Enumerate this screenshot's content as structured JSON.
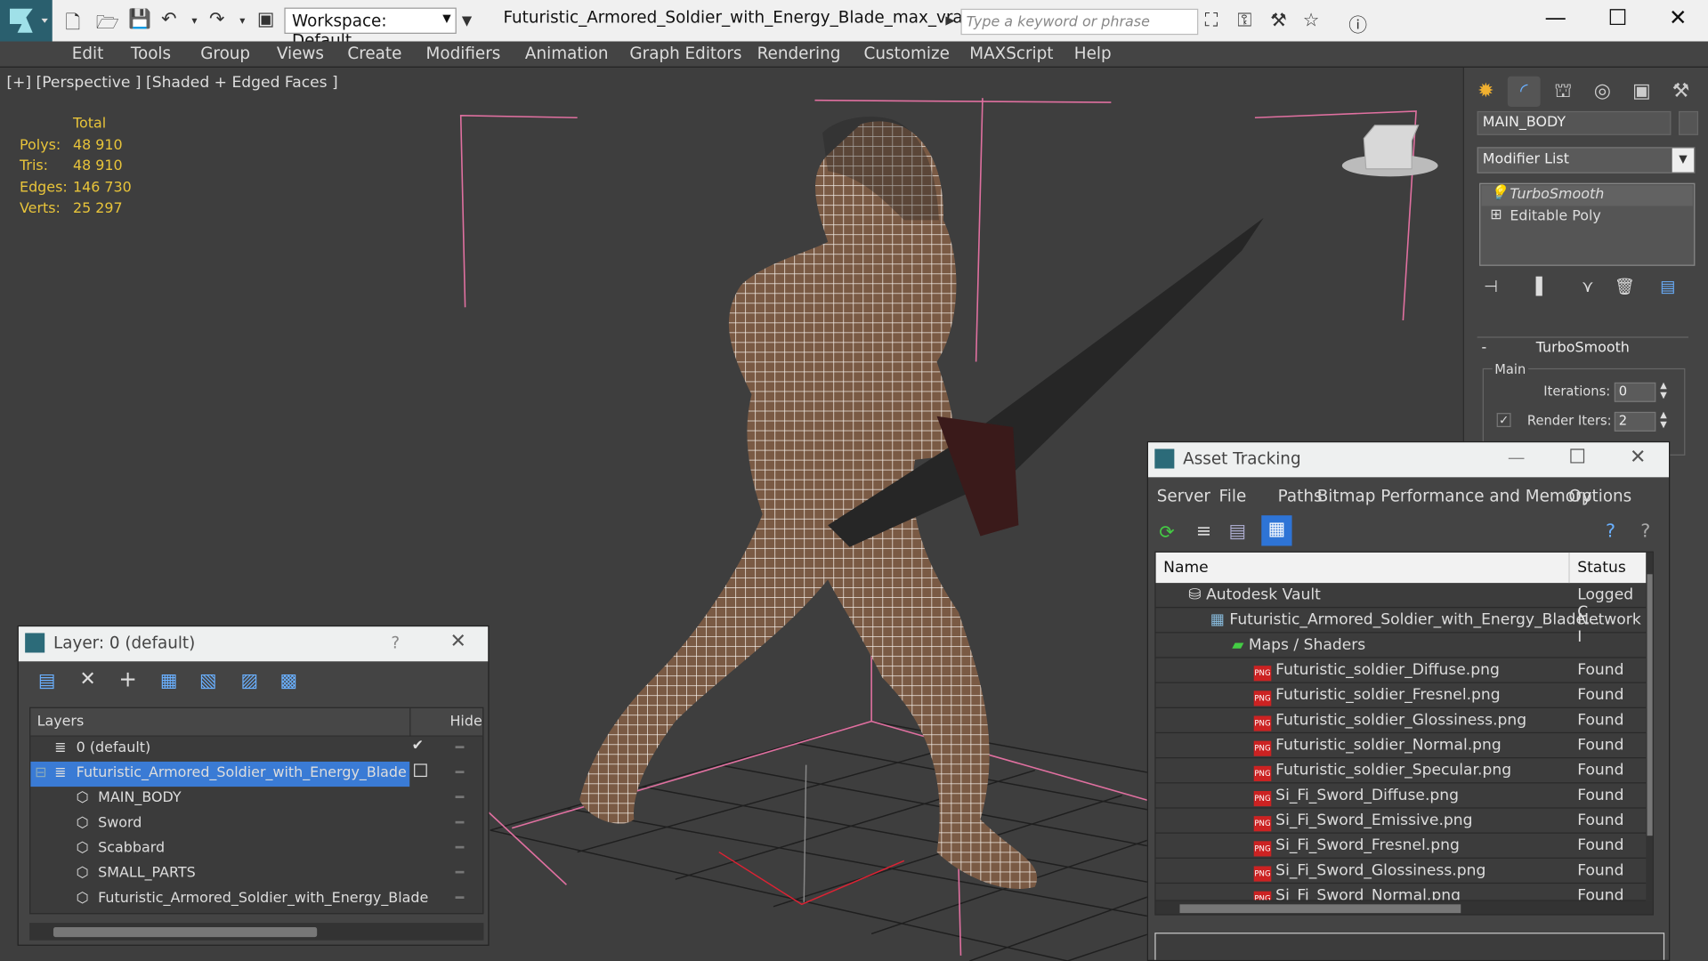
{
  "window": {
    "title": "Futuristic_Armored_Soldier_with_Energy_Blade_max_vray.max",
    "workspace": "Workspace: Default",
    "search_placeholder": "Type a keyword or phrase"
  },
  "menu": [
    "Edit",
    "Tools",
    "Group",
    "Views",
    "Create",
    "Modifiers",
    "Animation",
    "Graph Editors",
    "Rendering",
    "Customize",
    "MAXScript",
    "Help"
  ],
  "viewport": {
    "label": "[+] [Perspective ] [Shaded + Edged Faces ]"
  },
  "stats": {
    "header": "Total",
    "rows": [
      {
        "label": "Polys:",
        "value": "48 910"
      },
      {
        "label": "Tris:",
        "value": "48 910"
      },
      {
        "label": "Edges:",
        "value": "146 730"
      },
      {
        "label": "Verts:",
        "value": "25 297"
      }
    ]
  },
  "command_panel": {
    "object_name": "MAIN_BODY",
    "modifier_list": "Modifier List",
    "stack": [
      "TurboSmooth",
      "Editable Poly"
    ],
    "rollout_title": "TurboSmooth",
    "group_label": "Main",
    "iterations_label": "Iterations:",
    "iterations_value": "0",
    "render_iters_label": "Render Iters:",
    "render_iters_value": "2"
  },
  "layer_panel": {
    "title": "Layer: 0 (default)",
    "help": "?",
    "col_layers": "Layers",
    "col_hide": "Hide",
    "rows": [
      "0 (default)",
      "Futuristic_Armored_Soldier_with_Energy_Blade",
      "MAIN_BODY",
      "Sword",
      "Scabbard",
      "SMALL_PARTS",
      "Futuristic_Armored_Soldier_with_Energy_Blade"
    ]
  },
  "asset_panel": {
    "title": "Asset Tracking",
    "menu": [
      "Server",
      "File",
      "Paths",
      "Bitmap Performance and Memory",
      "Options"
    ],
    "col_name": "Name",
    "col_status": "Status",
    "rows": [
      {
        "name": "Autodesk Vault",
        "status": "Logged C"
      },
      {
        "name": "Futuristic_Armored_Soldier_with_Energy_Blade...",
        "status": "Network I"
      },
      {
        "name": "Maps / Shaders",
        "status": ""
      },
      {
        "name": "Futuristic_soldier_Diffuse.png",
        "status": "Found"
      },
      {
        "name": "Futuristic_soldier_Fresnel.png",
        "status": "Found"
      },
      {
        "name": "Futuristic_soldier_Glossiness.png",
        "status": "Found"
      },
      {
        "name": "Futuristic_soldier_Normal.png",
        "status": "Found"
      },
      {
        "name": "Futuristic_soldier_Specular.png",
        "status": "Found"
      },
      {
        "name": "Si_Fi_Sword_Diffuse.png",
        "status": "Found"
      },
      {
        "name": "Si_Fi_Sword_Emissive.png",
        "status": "Found"
      },
      {
        "name": "Si_Fi_Sword_Fresnel.png",
        "status": "Found"
      },
      {
        "name": "Si_Fi_Sword_Glossiness.png",
        "status": "Found"
      },
      {
        "name": "Si_Fi_Sword_Normal.png",
        "status": "Found"
      }
    ]
  },
  "colors": {
    "accent": "#2e74d6",
    "stats": "#e8c43a",
    "selection": "#3a7bd5"
  }
}
